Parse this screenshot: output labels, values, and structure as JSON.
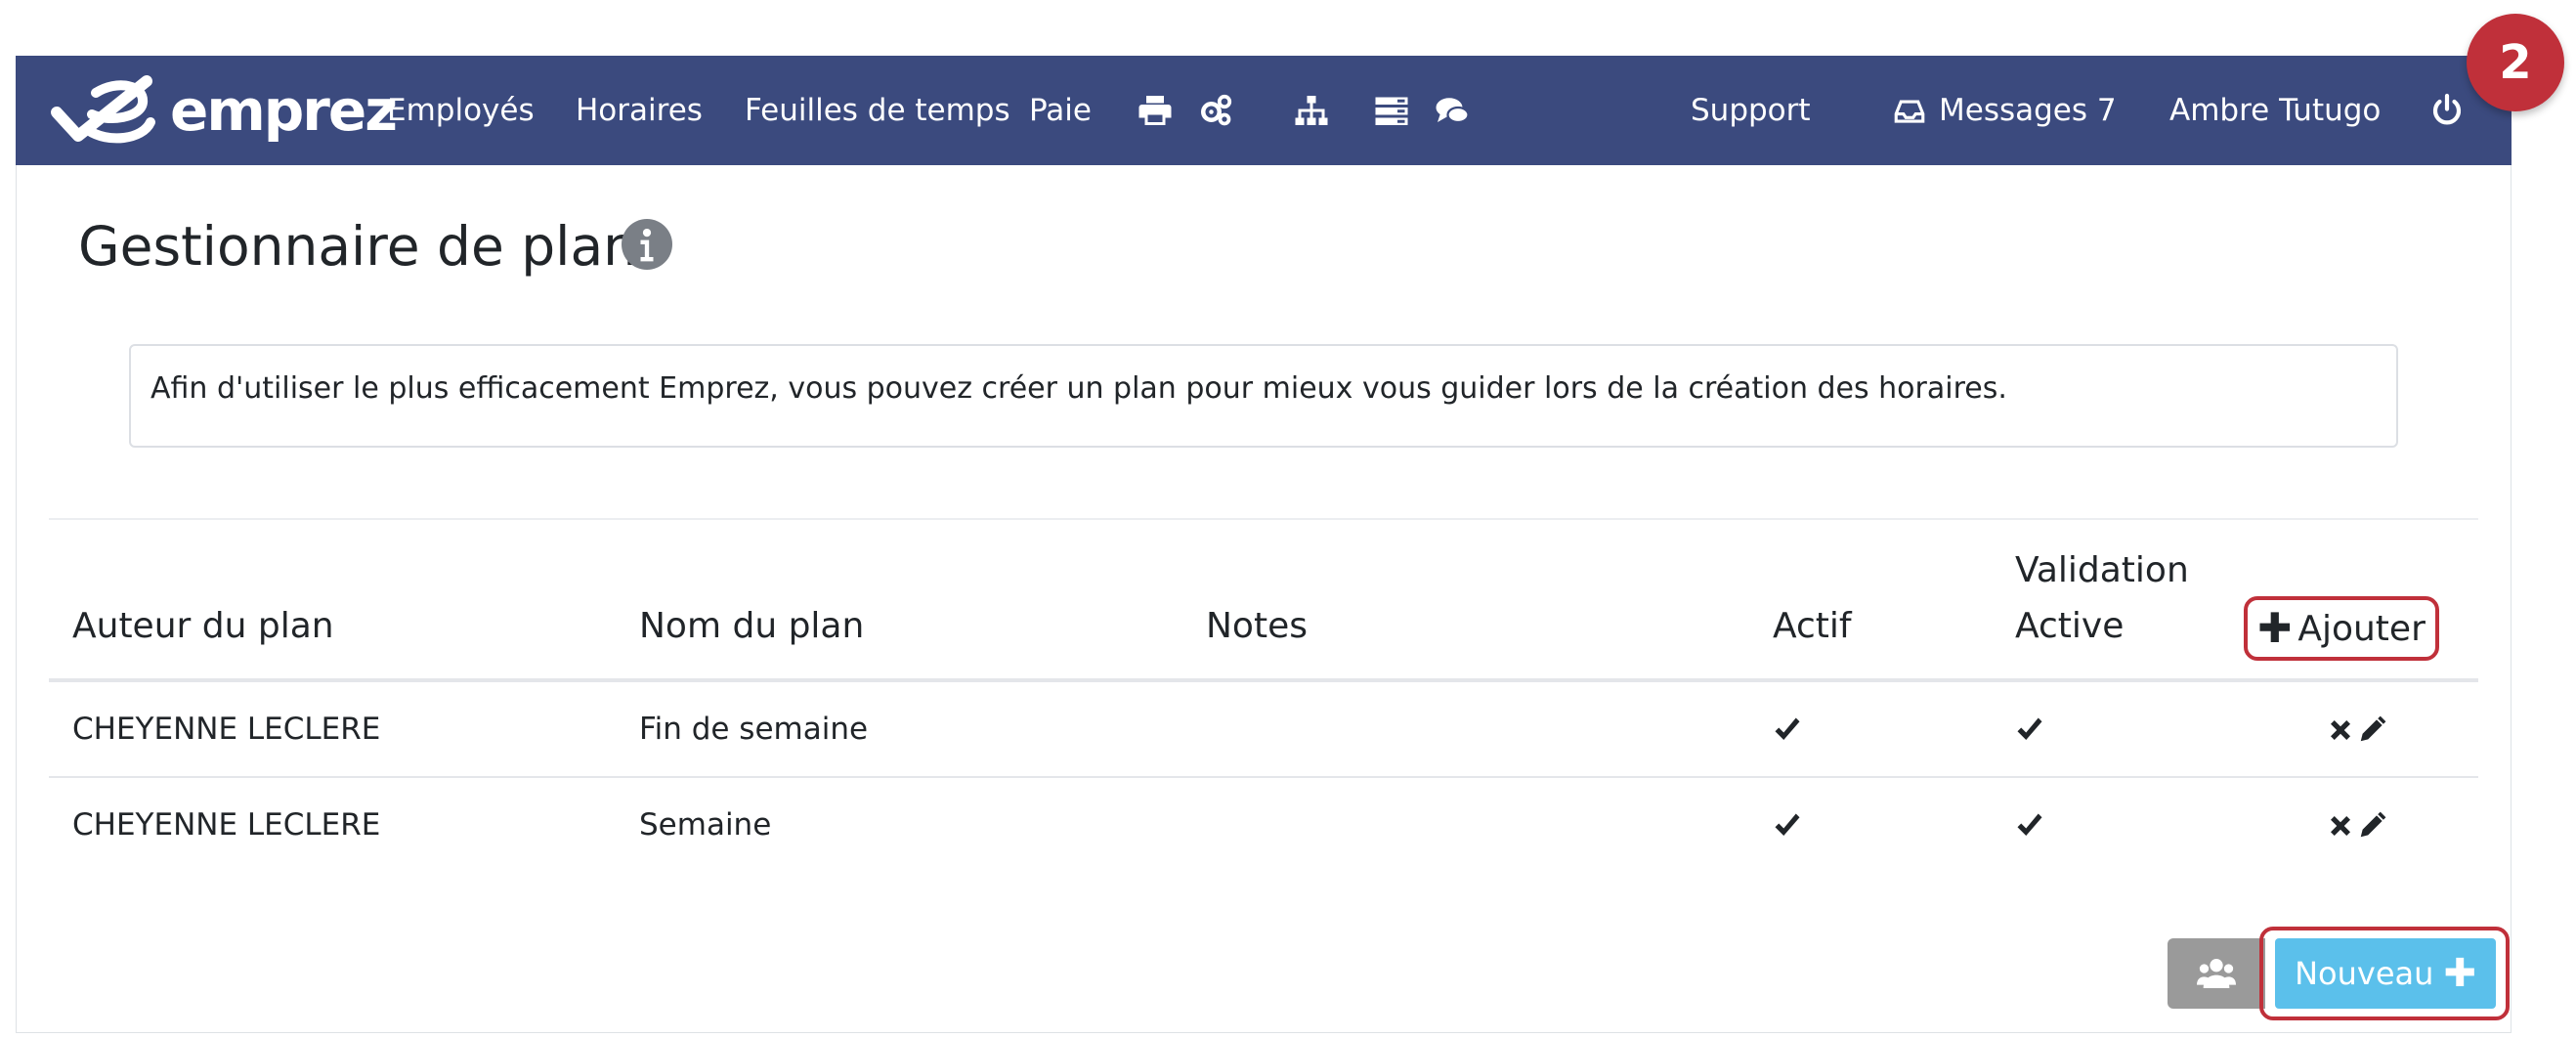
{
  "navbar": {
    "brand": "emprez",
    "items": [
      {
        "label": "Employés"
      },
      {
        "label": "Horaires"
      },
      {
        "label": "Feuilles de temps"
      },
      {
        "label": "Paie"
      }
    ],
    "icons": [
      "print-icon",
      "cogs-icon",
      "sitemap-icon",
      "server-icon",
      "comments-icon"
    ],
    "support": "Support",
    "messages": "Messages 7",
    "user": "Ambre Tutugo",
    "color": "#3b4a7e"
  },
  "badge": "2",
  "page": {
    "title": "Gestionnaire de plan",
    "info": "Afin d'utiliser le plus efficacement Emprez, vous pouvez créer un plan pour mieux vous guider lors de la création des horaires."
  },
  "table": {
    "headers": {
      "author": "Auteur du plan",
      "name": "Nom du plan",
      "notes": "Notes",
      "active": "Actif",
      "validation_line1": "Validation",
      "validation_line2": "Active",
      "add": "Ajouter"
    },
    "rows": [
      {
        "author": "CHEYENNE LECLERE",
        "name": "Fin de semaine",
        "notes": "",
        "active": true,
        "validation": true
      },
      {
        "author": "CHEYENNE LECLERE",
        "name": "Semaine",
        "notes": "",
        "active": true,
        "validation": true
      }
    ]
  },
  "buttons": {
    "new": "Nouveau",
    "new_color": "#5bc0eb",
    "highlight_color": "#c0303a"
  }
}
